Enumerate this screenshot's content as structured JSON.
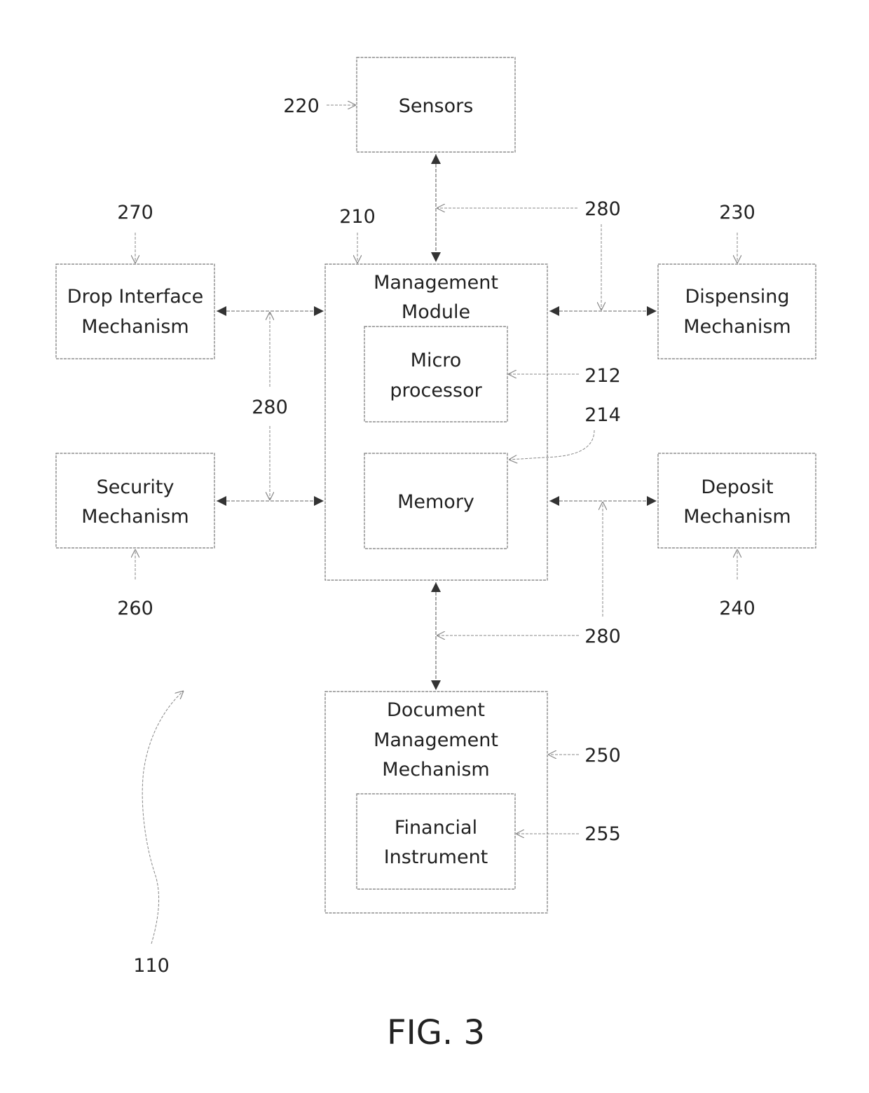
{
  "figure_label": "FIG. 3",
  "blocks": {
    "sensors": {
      "lines": [
        "Sensors"
      ],
      "ref": "220"
    },
    "management_module": {
      "lines": [
        "Management",
        "Module"
      ],
      "ref": "210"
    },
    "microprocessor": {
      "lines": [
        "Micro",
        "processor"
      ],
      "ref": "212"
    },
    "memory": {
      "lines": [
        "Memory"
      ],
      "ref": "214"
    },
    "drop_interface": {
      "lines": [
        "Drop Interface",
        "Mechanism"
      ],
      "ref": "270"
    },
    "security": {
      "lines": [
        "Security",
        "Mechanism"
      ],
      "ref": "260"
    },
    "dispensing": {
      "lines": [
        "Dispensing",
        "Mechanism"
      ],
      "ref": "230"
    },
    "deposit": {
      "lines": [
        "Deposit",
        "Mechanism"
      ],
      "ref": "240"
    },
    "document_management": {
      "lines": [
        "Document",
        "Management",
        "Mechanism"
      ],
      "ref": "250"
    },
    "financial_instrument": {
      "lines": [
        "Financial",
        "Instrument"
      ],
      "ref": "255"
    }
  },
  "connections": {
    "bus_ref": "280",
    "bus_ref_top": "280",
    "bus_ref_left": "280",
    "bus_ref_bottom": "280"
  },
  "system_ref": "110"
}
